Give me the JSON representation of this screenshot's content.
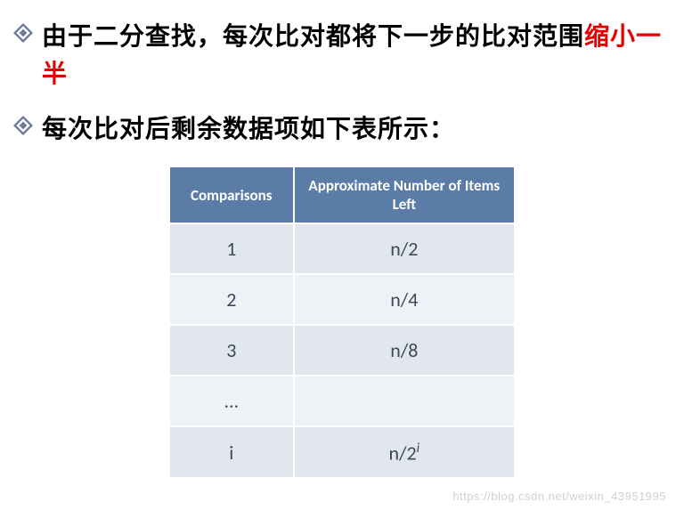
{
  "bullets": {
    "b1_part1": "由于二分查找，每次比对都将下一步的比对范围",
    "b1_highlight": "缩小一半",
    "b2": "每次比对后剩余数据项如下表所示："
  },
  "chart_data": {
    "type": "table",
    "headers": {
      "col1": "Comparisons",
      "col2": "Approximate Number of Items Left"
    },
    "rows": [
      {
        "comparisons": "1",
        "items_left": "n/2"
      },
      {
        "comparisons": "2",
        "items_left": "n/4"
      },
      {
        "comparisons": "3",
        "items_left": "n/8"
      },
      {
        "comparisons": "...",
        "items_left": ""
      },
      {
        "comparisons": "i",
        "items_left": "n/2^i"
      }
    ]
  },
  "watermark": "https://blog.csdn.net/weixin_43951995"
}
